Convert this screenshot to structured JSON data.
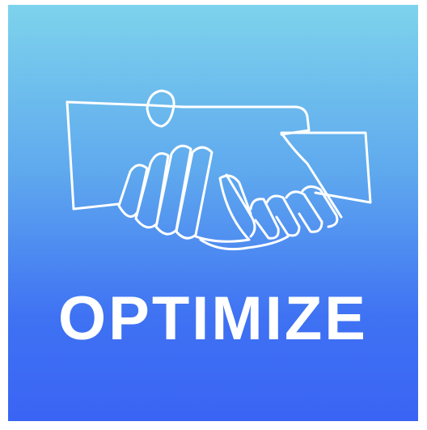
{
  "app_icon": {
    "name": "OPTIMIZE",
    "icon": "handshake-icon",
    "colors": {
      "gradient_top": "#7dd3ec",
      "gradient_bottom": "#3a64f4",
      "foreground": "#ffffff"
    }
  }
}
